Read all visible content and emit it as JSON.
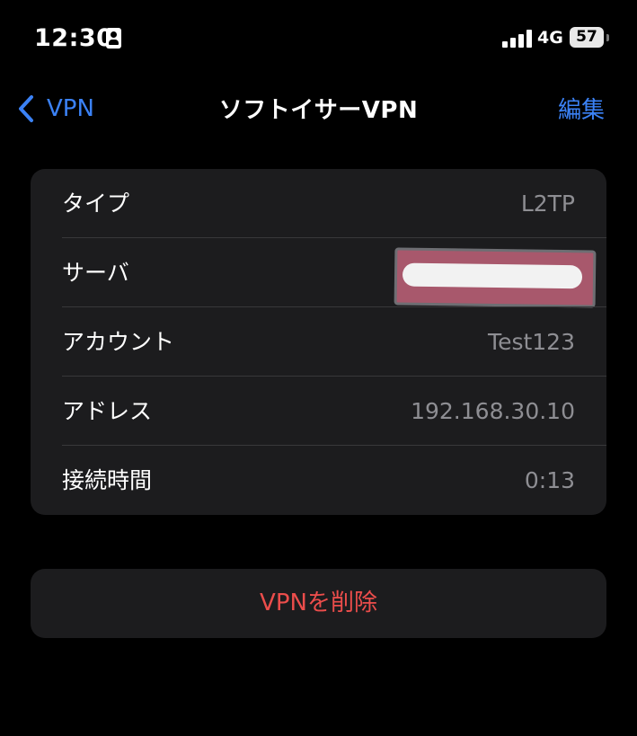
{
  "status_bar": {
    "time": "12:30",
    "network": "4G",
    "battery": "57"
  },
  "nav": {
    "back_label": "VPN",
    "title": "ソフトイサーVPN",
    "edit_label": "編集",
    "accent_color": "#3b82f6"
  },
  "details": {
    "rows": [
      {
        "label": "タイプ",
        "value": "L2TP"
      },
      {
        "label": "サーバ",
        "value": ""
      },
      {
        "label": "アカウント",
        "value": "Test123"
      },
      {
        "label": "アドレス",
        "value": "192.168.30.10"
      },
      {
        "label": "接続時間",
        "value": "0:13"
      }
    ]
  },
  "delete": {
    "label": "VPNを削除",
    "color": "#eb4d4b"
  }
}
